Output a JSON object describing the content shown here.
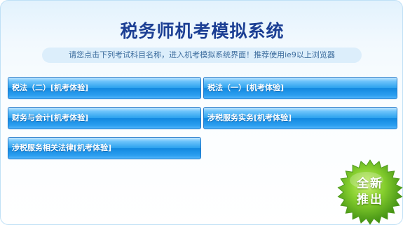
{
  "header": {
    "title": "税务师机考模拟系统",
    "notice": "请您点击下列考试科目名称，进入机考模拟系统界面！推荐使用ie9以上浏览器"
  },
  "exams": [
    {
      "label": "税法（二）[机考体验]"
    },
    {
      "label": "税法（一）[机考体验]"
    },
    {
      "label": "财务与会计[机考体验]"
    },
    {
      "label": "涉税服务实务[机考体验]"
    },
    {
      "label": "涉税服务相关法律[机考体验]"
    }
  ],
  "badge": {
    "line1": "全新",
    "line2": "推出"
  },
  "colors": {
    "title": "#1c3f94",
    "button_blue": "#1a8fe3",
    "badge_green": "#6fc12a",
    "notice_bg": "#dceefb"
  }
}
